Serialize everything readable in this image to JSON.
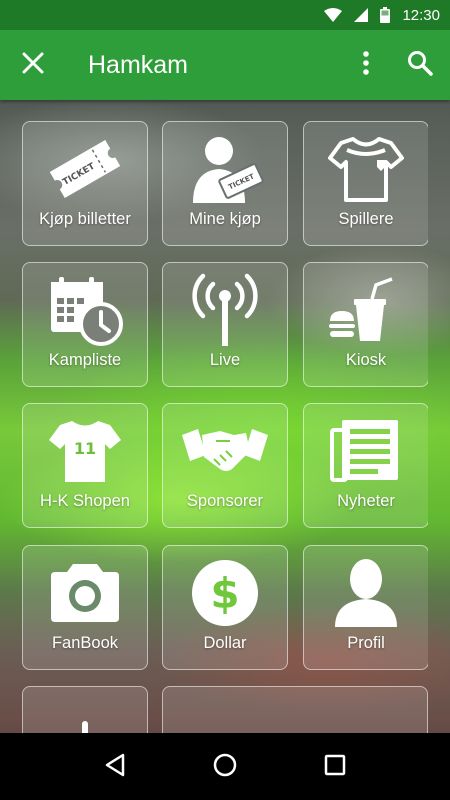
{
  "status_bar": {
    "time": "12:30"
  },
  "app_bar": {
    "title": "Hamkam"
  },
  "tiles": [
    {
      "label": "Kjøp billetter",
      "icon": "ticket-icon"
    },
    {
      "label": "Mine kjøp",
      "icon": "user-ticket-icon"
    },
    {
      "label": "Spillere",
      "icon": "jersey-icon"
    },
    {
      "label": "Kampliste",
      "icon": "calendar-clock-icon"
    },
    {
      "label": "Live",
      "icon": "broadcast-icon"
    },
    {
      "label": "Kiosk",
      "icon": "food-drink-icon"
    },
    {
      "label": "H-K Shopen",
      "icon": "jersey-number-icon"
    },
    {
      "label": "Sponsorer",
      "icon": "handshake-icon"
    },
    {
      "label": "Nyheter",
      "icon": "newspaper-icon"
    },
    {
      "label": "FanBook",
      "icon": "camera-icon"
    },
    {
      "label": "Dollar",
      "icon": "dollar-icon"
    },
    {
      "label": "Profil",
      "icon": "profile-icon"
    }
  ],
  "ticket_text": "TICKET",
  "jersey_number": "11"
}
